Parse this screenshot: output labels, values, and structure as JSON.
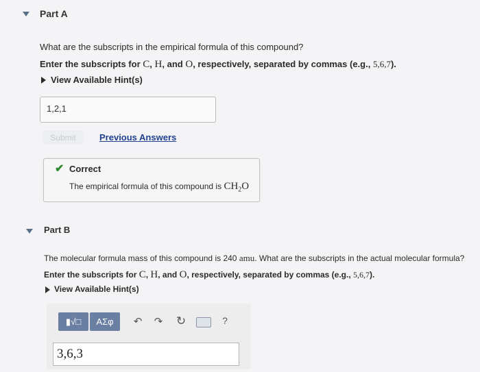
{
  "partA": {
    "title": "Part A",
    "question": "What are the subscripts in the empirical formula of this compound?",
    "instruction_prefix": "Enter the subscripts for",
    "el_c": "C",
    "comma1": ",",
    "el_h": "H",
    "and_word": ", and",
    "el_o": "O",
    "instruction_mid": ", respectively, separated by commas (e.g.,",
    "example": "5,6,7",
    "instruction_end": ").",
    "hint_label": "View Available Hint(s)",
    "answer_value": "1,2,1",
    "submit_label": "Submit",
    "previous_answers_label": "Previous Answers",
    "correct_label": "Correct",
    "feedback_prefix": "The empirical formula of this compound is",
    "formula_ch": "CH",
    "formula_sub": "2",
    "formula_o": "O"
  },
  "partB": {
    "title": "Part B",
    "question_prefix": "The molecular formula mass of this compound is 240",
    "unit": "amu",
    "question_rest": ". What are the subscripts in the actual molecular formula?",
    "instruction_prefix": "Enter the subscripts for",
    "el_c": "C",
    "comma1": ",",
    "el_h": "H",
    "and_word": ", and",
    "el_o": "O",
    "instruction_mid": ", respectively, separated by commas (e.g.,",
    "example": "5,6,7",
    "instruction_end": ").",
    "hint_label": "View Available Hint(s)",
    "templates_label": "▮√□",
    "symbols_label": "ΑΣφ",
    "undo_icon": "↶",
    "redo_icon": "↷",
    "reset_icon": "↻",
    "help_icon": "?",
    "answer_value": "3,6,3"
  }
}
